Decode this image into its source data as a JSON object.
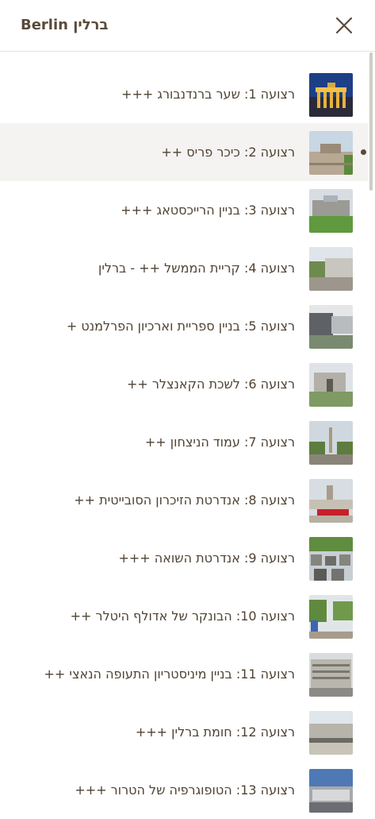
{
  "header": {
    "title": "ברלין Berlin"
  },
  "items": [
    {
      "label": "רצועה 1: שער ברנדנבורג +++"
    },
    {
      "label": "רצועה 2: כיכר פריס ++"
    },
    {
      "label": "רצועה 3: בניין הרייכסטאג +++"
    },
    {
      "label": "רצועה 4: קריית הממשל ++ - ברלין"
    },
    {
      "label": "רצועה 5: בניין ספריית וארכיון הפרלמנט +"
    },
    {
      "label": "רצועה 6: לשכת הקאנצלר ++"
    },
    {
      "label": "רצועה 7: עמוד הניצחון ++"
    },
    {
      "label": "רצועה 8: אנדרטת הזיכרון הסובייטית ++"
    },
    {
      "label": "רצועה 9: אנדרטת השואה +++"
    },
    {
      "label": "רצועה 10: הבונקר של אדולף היטלר ++"
    },
    {
      "label": "רצועה 11: בניין מיניסטריון התעופה הנאצי ++"
    },
    {
      "label": "רצועה 12: חומת ברלין +++"
    },
    {
      "label": "רצועה 13: הטופוגרפיה של הטרור +++"
    }
  ]
}
